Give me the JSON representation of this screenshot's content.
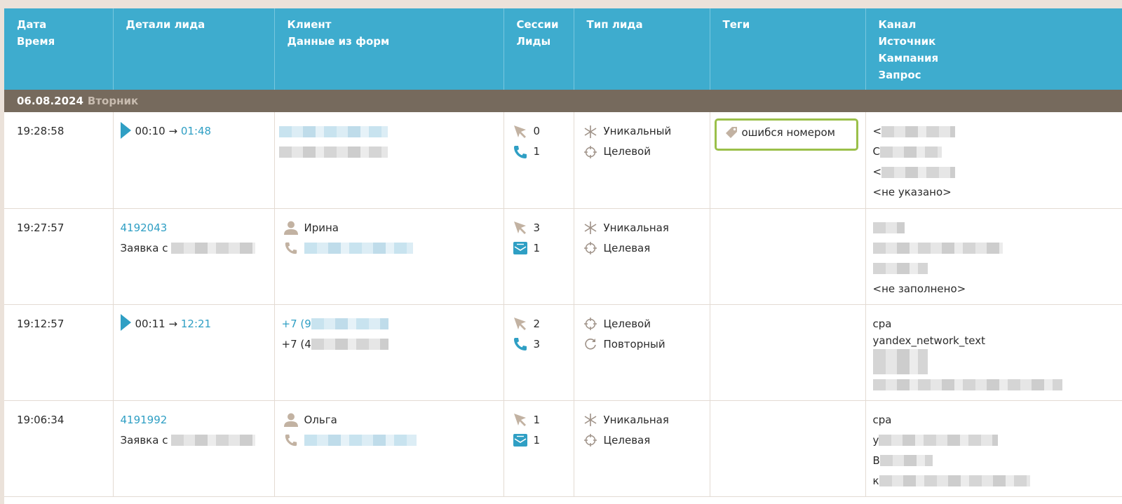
{
  "headers": {
    "col1": [
      "Дата",
      "Время"
    ],
    "col2": [
      "Детали лида"
    ],
    "col3": [
      "Клиент",
      "Данные из форм"
    ],
    "col4": [
      "Сессии",
      "Лиды"
    ],
    "col5": [
      "Тип лида"
    ],
    "col6": [
      "Теги"
    ],
    "col7": [
      "Канал",
      "Источник",
      "Кампания",
      "Запрос"
    ]
  },
  "date_group": {
    "date": "06.08.2024",
    "weekday": "Вторник"
  },
  "rows": [
    {
      "time": "19:28:58",
      "detail_type": "call",
      "call_wait": "00:10 →",
      "call_duration": "01:48",
      "client_lines": [
        "",
        ""
      ],
      "sessions": "0",
      "leads": "1",
      "lead_icon": "phone-icon",
      "type1": "Уникальный",
      "type1_icon": "asterisk-icon",
      "type2": "Целевой",
      "type2_icon": "crosshair-icon",
      "tag": "ошибся номером",
      "channel": [
        "<",
        "C",
        "<",
        "<не указано>"
      ]
    },
    {
      "time": "19:27:57",
      "detail_type": "form",
      "lead_id": "4192043",
      "form_label": "Заявка с",
      "client_name": "Ирина",
      "sessions": "3",
      "leads": "1",
      "lead_icon": "mail-icon",
      "type1": "Уникальная",
      "type1_icon": "asterisk-icon",
      "type2": "Целевая",
      "type2_icon": "crosshair-icon",
      "tag": "",
      "channel": [
        "",
        "",
        "",
        "<не заполнено>"
      ]
    },
    {
      "time": "19:12:57",
      "detail_type": "call",
      "call_wait": "00:11 →",
      "call_duration": "12:21",
      "client_lines": [
        "+7 (9",
        "+7 (4"
      ],
      "sessions": "2",
      "leads": "3",
      "lead_icon": "phone-icon",
      "type1": "Целевой",
      "type1_icon": "crosshair-icon",
      "type2": "Повторный",
      "type2_icon": "repeat-icon",
      "tag": "",
      "channel": [
        "cpa",
        "yandex_network_text",
        "",
        ""
      ]
    },
    {
      "time": "19:06:34",
      "detail_type": "form",
      "lead_id": "4191992",
      "form_label": "Заявка с",
      "client_name": "Ольга",
      "sessions": "1",
      "leads": "1",
      "lead_icon": "mail-icon",
      "type1": "Уникальная",
      "type1_icon": "asterisk-icon",
      "type2": "Целевая",
      "type2_icon": "crosshair-icon",
      "tag": "",
      "channel": [
        "cpa",
        "y",
        "B",
        "к"
      ]
    }
  ],
  "colors": {
    "header_bg": "#3eacce",
    "date_bg": "#766a5d",
    "link": "#2f9fc4",
    "tag_highlight": "#9bc04a",
    "icon_beige": "#c2b2a2"
  }
}
